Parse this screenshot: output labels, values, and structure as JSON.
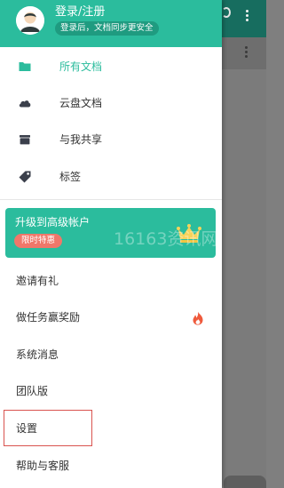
{
  "account": {
    "title": "登录/注册",
    "subtitle": "登录后，文档同步更安全"
  },
  "nav": [
    {
      "label": "所有文档",
      "icon": "folder-icon",
      "active": true
    },
    {
      "label": "云盘文档",
      "icon": "cloud-icon",
      "active": false
    },
    {
      "label": "与我共享",
      "icon": "shared-box-icon",
      "active": false
    },
    {
      "label": "标签",
      "icon": "tag-icon",
      "active": false
    }
  ],
  "upgrade": {
    "title": "升级到高级帐户",
    "badge": "限时特惠",
    "icon": "crown-icon"
  },
  "menu": [
    {
      "label": "邀请有礼"
    },
    {
      "label": "做任务赢奖励",
      "icon": "fire-icon"
    },
    {
      "label": "系统消息"
    },
    {
      "label": "团队版"
    },
    {
      "label": "设置"
    },
    {
      "label": "帮助与客服"
    }
  ],
  "watermark": "16163资讯网",
  "colors": {
    "accent": "#2bbc9d",
    "header": "#2bbc9d",
    "badge": "#f0776a",
    "highlight": "#d9534f",
    "fire": "#ef5a3c"
  }
}
